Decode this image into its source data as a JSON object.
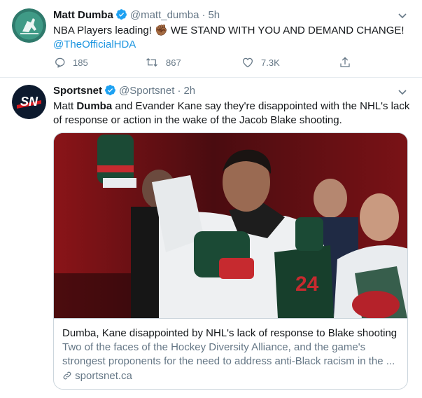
{
  "tweets": [
    {
      "display_name": "Matt Dumba",
      "handle": "@matt_dumba",
      "time": "5h",
      "text": "NBA Players leading! ✊🏾 WE STAND WITH YOU AND DEMAND CHANGE!",
      "mention": "@TheOfficialHDA",
      "replies": "185",
      "retweets": "867",
      "likes": "7.3K"
    },
    {
      "display_name": "Sportsnet",
      "handle": "@Sportsnet",
      "time": "2h",
      "avatar_text": "SN",
      "text_before": "Matt ",
      "text_bold": "Dumba",
      "text_after": " and Evander Kane say they're disappointed with the NHL's lack of response or action in the wake of the Jacob Blake shooting.",
      "card": {
        "title": "Dumba, Kane disappointed by NHL's lack of response to Blake shooting",
        "description": "Two of the faces of the Hockey Diversity Alliance, and the game's strongest proponents for the need to address anti-Black racism in the ...",
        "domain": "sportsnet.ca",
        "jersey_number": "24"
      }
    }
  ],
  "colors": {
    "link": "#1b95e0",
    "verified": "#1da1f2",
    "secondary_text": "#657786",
    "sportsnet_red": "#d7191f"
  }
}
